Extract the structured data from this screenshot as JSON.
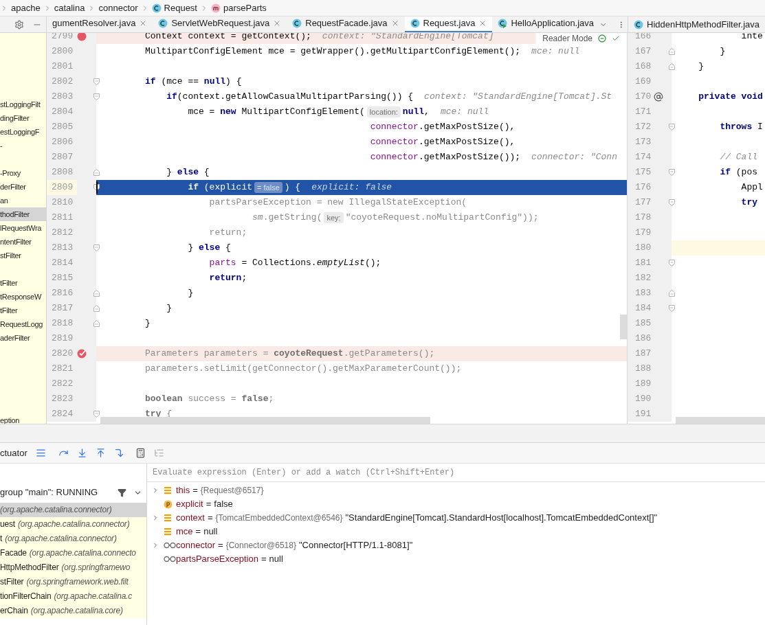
{
  "breadcrumbs": [
    {
      "label": "apache",
      "kind": "package"
    },
    {
      "label": "catalina",
      "kind": "package"
    },
    {
      "label": "connector",
      "kind": "package"
    },
    {
      "label": "Request",
      "kind": "class"
    },
    {
      "label": "parseParts",
      "kind": "method"
    }
  ],
  "editor_tabs": [
    {
      "label": "gumentResolver.java",
      "closable": true,
      "selected": false
    },
    {
      "label": "ServletWebRequest.java",
      "kind": "class",
      "closable": true,
      "selected": false
    },
    {
      "label": "RequestFacade.java",
      "kind": "class",
      "closable": true,
      "selected": false
    },
    {
      "label": "Request.java",
      "kind": "class",
      "closable": true,
      "selected": true
    },
    {
      "label": "HelloApplication.java",
      "kind": "app",
      "closable": false,
      "selected": false
    }
  ],
  "project_tree": [
    {
      "kind": "item",
      "label": "stLoggingFilt",
      "selected": false
    },
    {
      "kind": "item",
      "label": "dingFilter",
      "selected": false
    },
    {
      "kind": "item",
      "label": "estLoggingF",
      "selected": false
    },
    {
      "kind": "item",
      "label": "-",
      "selected": false
    },
    {
      "kind": "gap"
    },
    {
      "kind": "item",
      "label": "-Proxy",
      "selected": false
    },
    {
      "kind": "item",
      "label": "derFilter",
      "selected": false
    },
    {
      "kind": "item",
      "label": "an",
      "selected": false
    },
    {
      "kind": "item",
      "label": "thodFilter",
      "selected": true
    },
    {
      "kind": "item",
      "label": "lRequestWra",
      "selected": false
    },
    {
      "kind": "item",
      "label": "ntentFilter",
      "selected": false
    },
    {
      "kind": "item",
      "label": "stFilter",
      "selected": false
    },
    {
      "kind": "gap"
    },
    {
      "kind": "item",
      "label": "tFilter",
      "selected": false
    },
    {
      "kind": "item",
      "label": "tResponseW",
      "selected": false
    },
    {
      "kind": "item",
      "label": "tFilter",
      "selected": false
    },
    {
      "kind": "item",
      "label": "RequestLogg",
      "selected": false
    },
    {
      "kind": "item",
      "label": "aderFilter",
      "selected": false
    },
    {
      "kind": "gap"
    },
    {
      "kind": "gap"
    },
    {
      "kind": "gap"
    },
    {
      "kind": "gap"
    },
    {
      "kind": "gap"
    },
    {
      "kind": "item",
      "label": "eption",
      "selected": false
    }
  ],
  "editor": {
    "reader_mode": "Reader Mode",
    "lines": [
      {
        "number": "2799",
        "kind": "breakpoint",
        "gutter_marks": [
          {
            "kind": "breakpoint"
          }
        ],
        "tokens": [
          {
            "t": "Context context = getContext();",
            "kind": "plain"
          },
          {
            "t": "context: \"StandardEngine[Tomcat]",
            "kind": "hint"
          }
        ]
      },
      {
        "number": "2800",
        "kind": "plain",
        "tokens": [
          {
            "t": "MultipartConfigElement mce = getWrapper().getMultipartConfigElement();",
            "kind": "plain"
          },
          {
            "t": "mce: null",
            "kind": "hint"
          }
        ]
      },
      {
        "number": "2801",
        "kind": "plain"
      },
      {
        "number": "2802",
        "kind": "plain",
        "gutter_marks": [
          {
            "kind": "fold-start"
          }
        ],
        "tokens": [
          {
            "t": "if",
            "kind": "kw"
          },
          {
            "t": " (mce == ",
            "kind": "plain"
          },
          {
            "t": "null",
            "kind": "kw"
          },
          {
            "t": ") {",
            "kind": "plain"
          }
        ]
      },
      {
        "number": "2803",
        "kind": "plain",
        "gutter_marks": [
          {
            "kind": "fold-start"
          }
        ],
        "tokens": [
          {
            "t": "    if",
            "kind": "kw"
          },
          {
            "t": "(context.getAllowCasualMultipartParsing()) {",
            "kind": "plain"
          },
          {
            "t": "context: \"StandardEngine[Tomcat].St",
            "kind": "hint"
          }
        ]
      },
      {
        "number": "2804",
        "kind": "plain",
        "tokens": [
          {
            "t": "        mce = ",
            "kind": "plain"
          },
          {
            "t": "new",
            "kind": "kw"
          },
          {
            "t": " MultipartConfigElement(",
            "kind": "plain"
          },
          {
            "t": "location:",
            "kind": "pill"
          },
          {
            "t": "null",
            "kind": "kw"
          },
          {
            "t": ",",
            "kind": "plain"
          },
          {
            "t": "mce: null",
            "kind": "hint"
          }
        ]
      },
      {
        "number": "2805",
        "kind": "plain",
        "tokens": [
          {
            "t": "                                          connector",
            "kind": "field"
          },
          {
            "t": ".getMaxPostSize(),",
            "kind": "plain"
          }
        ]
      },
      {
        "number": "2806",
        "kind": "plain",
        "tokens": [
          {
            "t": "                                          connector",
            "kind": "field"
          },
          {
            "t": ".getMaxPostSize(),",
            "kind": "plain"
          }
        ]
      },
      {
        "number": "2807",
        "kind": "plain",
        "tokens": [
          {
            "t": "                                          connector",
            "kind": "field"
          },
          {
            "t": ".getMaxPostSize());",
            "kind": "plain"
          },
          {
            "t": "connector: \"Conn",
            "kind": "hint"
          }
        ]
      },
      {
        "number": "2808",
        "kind": "plain",
        "gutter_marks": [
          {
            "kind": "fold-end"
          }
        ],
        "tokens": [
          {
            "t": "    } ",
            "kind": "plain"
          },
          {
            "t": "else",
            "kind": "kw"
          },
          {
            "t": " {",
            "kind": "plain"
          }
        ]
      },
      {
        "number": "2809",
        "kind": "current",
        "gutter_marks": [
          {
            "kind": "fold-start"
          }
        ],
        "tokens": [
          {
            "t": "        if",
            "kind": "kw"
          },
          {
            "t": " (explicit",
            "kind": "plain"
          },
          {
            "t": "= false",
            "kind": "pill"
          },
          {
            "t": ") {",
            "kind": "plain"
          },
          {
            "t": "explicit: false",
            "kind": "hint"
          }
        ]
      },
      {
        "number": "2810",
        "kind": "plain",
        "tokens": [
          {
            "t": "            partsParseException = new IllegalStateException(",
            "kind": "dim"
          }
        ]
      },
      {
        "number": "2811",
        "kind": "plain",
        "tokens": [
          {
            "t": "                    sm",
            "kind": "dimitalic"
          },
          {
            "t": ".getString(",
            "kind": "dim"
          },
          {
            "t": "key:",
            "kind": "pill"
          },
          {
            "t": "\"coyoteRequest.noMultipartConfig\"));",
            "kind": "dim"
          }
        ]
      },
      {
        "number": "2812",
        "kind": "plain",
        "tokens": [
          {
            "t": "            return;",
            "kind": "dim"
          }
        ]
      },
      {
        "number": "2813",
        "kind": "plain",
        "gutter_marks": [
          {
            "kind": "fold-start"
          }
        ],
        "tokens": [
          {
            "t": "        } ",
            "kind": "plain"
          },
          {
            "t": "else",
            "kind": "kw"
          },
          {
            "t": " {",
            "kind": "plain"
          }
        ]
      },
      {
        "number": "2814",
        "kind": "plain",
        "tokens": [
          {
            "t": "            parts",
            "kind": "field"
          },
          {
            "t": " = Collections.",
            "kind": "plain"
          },
          {
            "t": "emptyList",
            "kind": "italic"
          },
          {
            "t": "();",
            "kind": "plain"
          }
        ]
      },
      {
        "number": "2815",
        "kind": "plain",
        "tokens": [
          {
            "t": "            return",
            "kind": "kw"
          },
          {
            "t": ";",
            "kind": "plain"
          }
        ]
      },
      {
        "number": "2816",
        "kind": "plain",
        "gutter_marks": [
          {
            "kind": "fold-end"
          }
        ],
        "tokens": [
          {
            "t": "        }",
            "kind": "plain"
          }
        ]
      },
      {
        "number": "2817",
        "kind": "plain",
        "gutter_marks": [
          {
            "kind": "fold-end"
          }
        ],
        "tokens": [
          {
            "t": "    }",
            "kind": "plain"
          }
        ]
      },
      {
        "number": "2818",
        "kind": "plain",
        "gutter_marks": [
          {
            "kind": "fold-end"
          }
        ],
        "tokens": [
          {
            "t": "}",
            "kind": "plain"
          }
        ]
      },
      {
        "number": "2819",
        "kind": "plain"
      },
      {
        "number": "2820",
        "kind": "breakpoint",
        "gutter_marks": [
          {
            "kind": "breakpoint-check"
          }
        ],
        "tokens": [
          {
            "t": "Parameters parameters = ",
            "kind": "dim"
          },
          {
            "t": "coyoteRequest",
            "kind": "dimbold"
          },
          {
            "t": ".getParameters();",
            "kind": "dim"
          }
        ]
      },
      {
        "number": "2821",
        "kind": "plain",
        "tokens": [
          {
            "t": "parameters.setLimit(getConnector().getMaxParameterCount());",
            "kind": "dim"
          }
        ]
      },
      {
        "number": "2822",
        "kind": "plain"
      },
      {
        "number": "2823",
        "kind": "plain",
        "tokens": [
          {
            "t": "boolean",
            "kind": "dimbold"
          },
          {
            "t": " success = ",
            "kind": "dim"
          },
          {
            "t": "false",
            "kind": "dimbold"
          },
          {
            "t": ";",
            "kind": "dim"
          }
        ]
      },
      {
        "number": "2824",
        "kind": "plain",
        "gutter_marks": [
          {
            "kind": "fold-start"
          }
        ],
        "tokens": [
          {
            "t": "try",
            "kind": "dimbold"
          },
          {
            "t": " {",
            "kind": "dim"
          }
        ]
      }
    ]
  },
  "split_editor": {
    "tab": {
      "label": "HiddenHttpMethodFilter.java",
      "kind": "class"
    },
    "lines": [
      {
        "number": "166",
        "kind": "plain",
        "tokens": [
          {
            "t": "            inte",
            "kind": "plain"
          }
        ]
      },
      {
        "number": "167",
        "kind": "plain",
        "gutter_marks": [
          {
            "kind": "fold-end"
          }
        ],
        "tokens": [
          {
            "t": "        }",
            "kind": "plain"
          }
        ]
      },
      {
        "number": "168",
        "kind": "plain",
        "gutter_marks": [
          {
            "kind": "fold-end"
          }
        ],
        "tokens": [
          {
            "t": "    }",
            "kind": "plain"
          }
        ]
      },
      {
        "number": "169",
        "kind": "plain"
      },
      {
        "number": "170",
        "kind": "plain",
        "gutter_marks": [
          {
            "kind": "override"
          }
        ],
        "tokens": [
          {
            "t": "    private void",
            "kind": "kw"
          }
        ]
      },
      {
        "number": "171",
        "kind": "plain"
      },
      {
        "number": "172",
        "kind": "plain",
        "gutter_marks": [
          {
            "kind": "fold-start"
          }
        ],
        "tokens": [
          {
            "t": "        throws",
            "kind": "kw"
          },
          {
            "t": " I",
            "kind": "plain"
          }
        ]
      },
      {
        "number": "173",
        "kind": "plain"
      },
      {
        "number": "174",
        "kind": "plain",
        "tokens": [
          {
            "t": "        // Call",
            "kind": "comment"
          }
        ]
      },
      {
        "number": "175",
        "kind": "plain",
        "gutter_marks": [
          {
            "kind": "fold-start"
          }
        ],
        "tokens": [
          {
            "t": "        if",
            "kind": "kw"
          },
          {
            "t": " (pos",
            "kind": "plain"
          }
        ]
      },
      {
        "number": "176",
        "kind": "plain",
        "tokens": [
          {
            "t": "            Appl",
            "kind": "plain"
          }
        ]
      },
      {
        "number": "177",
        "kind": "plain",
        "gutter_marks": [
          {
            "kind": "fold-start"
          }
        ],
        "tokens": [
          {
            "t": "            try",
            "kind": "kw"
          }
        ]
      },
      {
        "number": "178",
        "kind": "plain"
      },
      {
        "number": "179",
        "kind": "plain"
      },
      {
        "number": "180",
        "kind": "caret"
      },
      {
        "number": "181",
        "kind": "plain",
        "gutter_marks": [
          {
            "kind": "fold-start"
          }
        ]
      },
      {
        "number": "182",
        "kind": "plain"
      },
      {
        "number": "183",
        "kind": "plain",
        "gutter_marks": [
          {
            "kind": "fold-end"
          }
        ]
      },
      {
        "number": "184",
        "kind": "plain",
        "gutter_marks": [
          {
            "kind": "fold-start"
          }
        ]
      },
      {
        "number": "185",
        "kind": "plain"
      },
      {
        "number": "186",
        "kind": "plain"
      },
      {
        "number": "187",
        "kind": "plain"
      },
      {
        "number": "188",
        "kind": "plain"
      },
      {
        "number": "189",
        "kind": "plain"
      },
      {
        "number": "190",
        "kind": "plain"
      },
      {
        "number": "191",
        "kind": "plain"
      }
    ]
  },
  "debugger": {
    "tab_label": "ctuator",
    "evaluate": {
      "placeholder": "Evaluate expression (Enter) or add a watch (Ctrl+Shift+Enter)"
    },
    "thread": "group \"main\": RUNNING",
    "frames": [
      {
        "package": "(org.apache.catalina.connector)",
        "selected": true
      },
      {
        "method": "uest",
        "package": "(org.apache.catalina.connector)",
        "selected": false
      },
      {
        "method": "t",
        "package": "(org.apache.catalina.connector)",
        "selected": false
      },
      {
        "method": "Facade",
        "package": "(org.apache.catalina.connecto",
        "selected": false
      },
      {
        "method": "HttpMethodFilter",
        "package": "(org.springframewo",
        "selected": false
      },
      {
        "method": "stFilter",
        "package": "(org.springframework.web.filt",
        "selected": false
      },
      {
        "method": "tionFilterChain",
        "package": "(org.apache.catalina.c",
        "selected": false
      },
      {
        "method": "erChain",
        "package": "(org.apache.catalina.core)",
        "selected": false
      }
    ],
    "variables": [
      {
        "kind": "field",
        "expandable": true,
        "name": "this",
        "operator": "=",
        "ref": "{Request@6517}"
      },
      {
        "kind": "param",
        "expandable": false,
        "name": "explicit",
        "operator": "=",
        "value": "false"
      },
      {
        "kind": "field",
        "expandable": true,
        "name": "context",
        "operator": "=",
        "ref": "{TomcatEmbeddedContext@6546}",
        "value": "\"StandardEngine[Tomcat].StandardHost[localhost].TomcatEmbeddedContext[]\""
      },
      {
        "kind": "field",
        "expandable": false,
        "name": "mce",
        "operator": "=",
        "value": "null"
      },
      {
        "kind": "watch",
        "expandable": true,
        "name": "connector",
        "operator": "=",
        "ref": "{Connector@6518}",
        "value": "\"Connector[HTTP/1.1-8081]\""
      },
      {
        "kind": "watch",
        "expandable": false,
        "name": "partsParseException",
        "operator": "=",
        "value": "null"
      }
    ]
  }
}
